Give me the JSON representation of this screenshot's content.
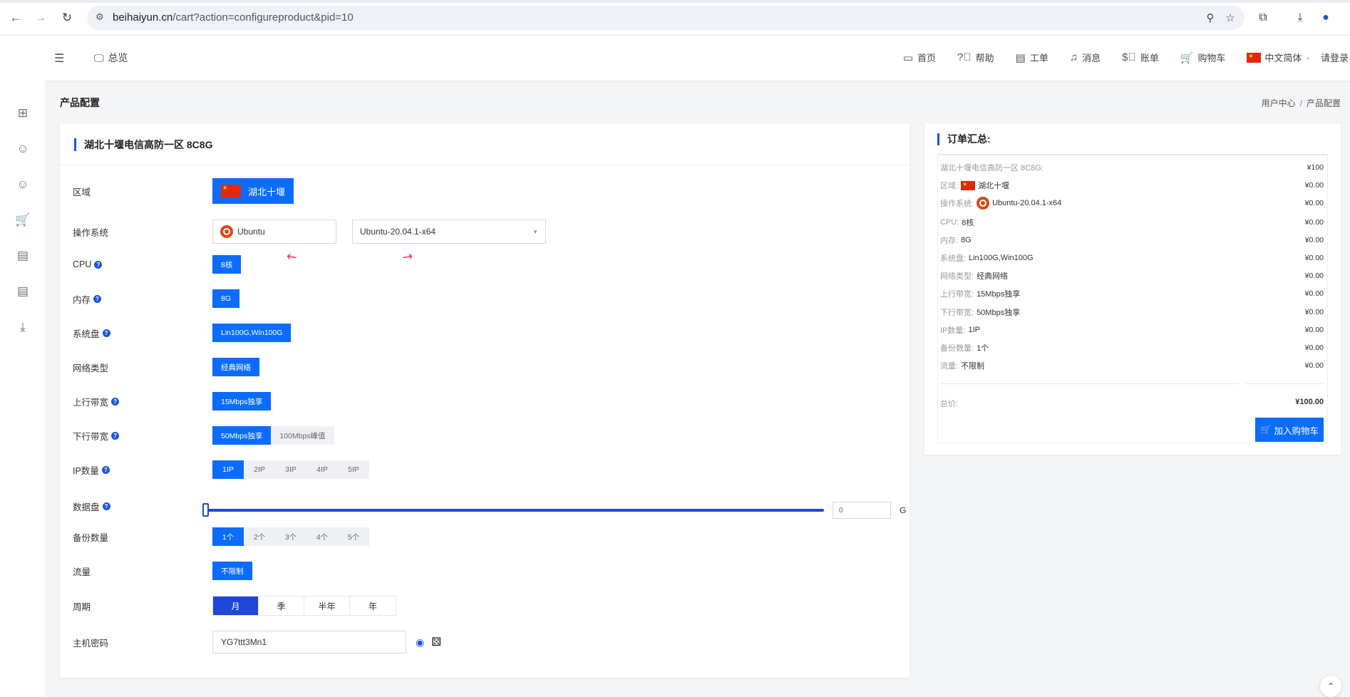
{
  "browser": {
    "url_host": "beihaiyun.cn",
    "url_path": "/cart?action=configureproduct&pid=10"
  },
  "header": {
    "overview_label": "总览",
    "nav": [
      {
        "label": "首页",
        "icon": "monitor-chat-icon"
      },
      {
        "label": "帮助",
        "icon": "help-circle-icon"
      },
      {
        "label": "工单",
        "icon": "ticket-icon"
      },
      {
        "label": "消息",
        "icon": "bell-icon"
      },
      {
        "label": "账单",
        "icon": "dollar-circle-icon"
      },
      {
        "label": "购物车",
        "icon": "cart-icon"
      }
    ],
    "language": "中文简体",
    "login": "请登录"
  },
  "page": {
    "title": "产品配置",
    "breadcrumb": [
      "用户中心",
      "产品配置"
    ]
  },
  "product": {
    "title": "湖北十堰电信高防一区 8C8G",
    "region_label": "区域",
    "region_value": "湖北十堰",
    "os_label": "操作系统",
    "os_family": "Ubuntu",
    "os_version": "Ubuntu-20.04.1-x64",
    "cpu_label": "CPU",
    "cpu_value": "8核",
    "memory_label": "内存",
    "memory_value": "8G",
    "system_disk_label": "系统盘",
    "system_disk_value": "Lin100G,Win100G",
    "network_label": "网络类型",
    "network_value": "经典网络",
    "upload_label": "上行带宽",
    "upload_value": "15Mbps独享",
    "download_label": "下行带宽",
    "download_options": [
      "50Mbps独享",
      "100Mbps峰值"
    ],
    "download_selected": 0,
    "ip_label": "IP数量",
    "ip_options": [
      "1IP",
      "2IP",
      "3IP",
      "4IP",
      "5IP"
    ],
    "ip_selected": 0,
    "datadisk_label": "数据盘",
    "datadisk_value": "0",
    "datadisk_unit": "G",
    "datadisk_level": 0,
    "backup_label": "备份数量",
    "backup_options": [
      "1个",
      "2个",
      "3个",
      "4个",
      "5个"
    ],
    "backup_selected": 0,
    "traffic_label": "流量",
    "traffic_value": "不限制",
    "period_label": "周期",
    "period_options": [
      "月",
      "季",
      "半年",
      "年"
    ],
    "period_selected": 0,
    "password_label": "主机密码",
    "password_value": "YG7ttt3Mn1"
  },
  "summary": {
    "title": "订单汇总:",
    "rows": [
      {
        "key": "湖北十堰电信高防一区 8C8G:",
        "value": "",
        "amount": "¥100"
      },
      {
        "key": "区域:",
        "value": "湖北十堰",
        "amount": "¥0.00",
        "flag": true
      },
      {
        "key": "操作系统:",
        "value": "Ubuntu-20.04.1-x64",
        "amount": "¥0.00",
        "os": true
      },
      {
        "key": "CPU:",
        "value": "8核",
        "amount": "¥0.00"
      },
      {
        "key": "内存:",
        "value": "8G",
        "amount": "¥0.00"
      },
      {
        "key": "系统盘:",
        "value": "Lin100G,Win100G",
        "amount": "¥0.00"
      },
      {
        "key": "网络类型:",
        "value": "经典网络",
        "amount": "¥0.00"
      },
      {
        "key": "上行带宽:",
        "value": "15Mbps独享",
        "amount": "¥0.00"
      },
      {
        "key": "下行带宽:",
        "value": "50Mbps独享",
        "amount": "¥0.00"
      },
      {
        "key": "IP数量:",
        "value": "1IP",
        "amount": "¥0.00"
      },
      {
        "key": "备份数量:",
        "value": "1个",
        "amount": "¥0.00"
      },
      {
        "key": "流量:",
        "value": "不限制",
        "amount": "¥0.00"
      }
    ],
    "total_label": "总价:",
    "total_amount": "¥100.00",
    "add_cart": "加入购物车"
  },
  "colors": {
    "primary": "#0b6cff",
    "period_active": "#1f47d8",
    "accent_bar": "#1a56db",
    "arrow": "#e8384f"
  }
}
